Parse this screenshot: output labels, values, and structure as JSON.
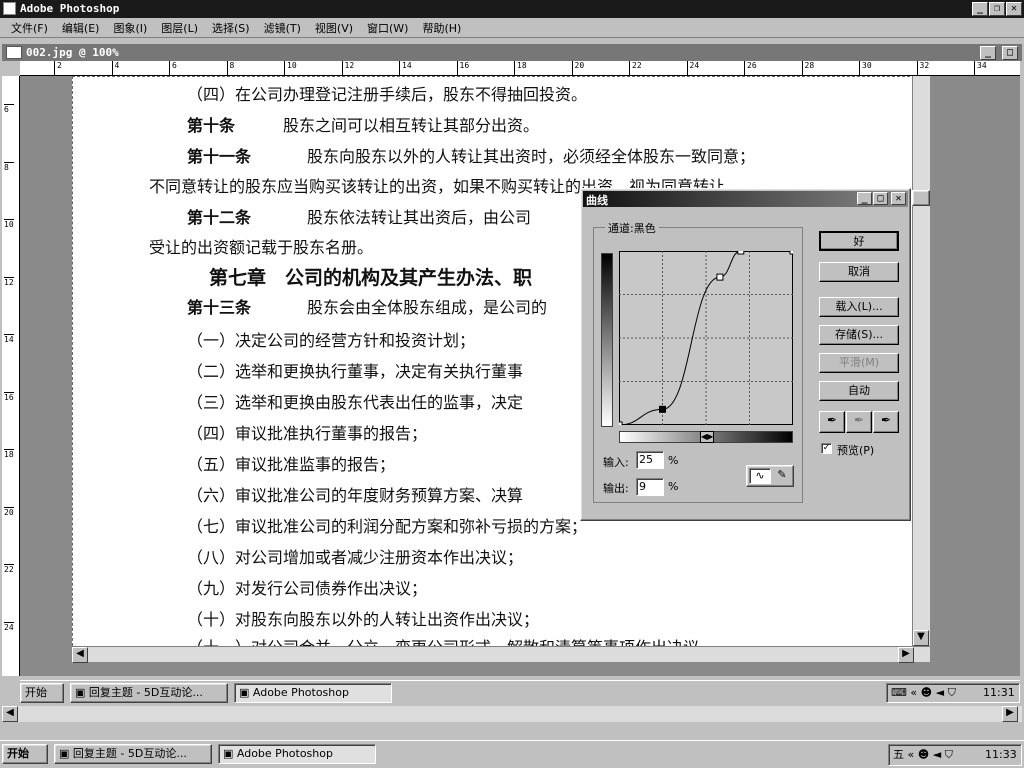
{
  "app": {
    "title": "Adobe Photoshop"
  },
  "menu": [
    "文件(F)",
    "编辑(E)",
    "图象(I)",
    "图层(L)",
    "选择(S)",
    "滤镜(T)",
    "视图(V)",
    "窗口(W)",
    "帮助(H)"
  ],
  "document": {
    "title": "002.jpg @ 100%",
    "ruler_h": [
      "2",
      "4",
      "6",
      "8",
      "10",
      "12",
      "14",
      "16",
      "18",
      "20",
      "22",
      "24",
      "26",
      "28",
      "30",
      "32",
      "34"
    ],
    "ruler_v": [
      "6",
      "8",
      "10",
      "12",
      "14",
      "16",
      "18",
      "20",
      "22",
      "24"
    ],
    "lines": [
      "（四）在公司办理登记注册手续后，股东不得抽回投资。",
      "第十条",
      "股东之间可以相互转让其部分出资。",
      "第十一条",
      "股东向股东以外的人转让其出资时，必须经全体股东一致同意；",
      "不同意转让的股东应当购买该转让的出资，如果不购买转让的出资，视为同意转让。",
      "第十二条",
      "股东依法转让其出资后，由公司",
      "受让的出资额记载于股东名册。",
      "第七章　公司的机构及其产生办法、职",
      "第十三条",
      "股东会由全体股东组成，是公司的",
      "（一）决定公司的经营方针和投资计划；",
      "（二）选举和更换执行董事，决定有关执行董事",
      "（三）选举和更换由股东代表出任的监事，决定",
      "（四）审议批准执行董事的报告；",
      "（五）审议批准监事的报告；",
      "（六）审议批准公司的年度财务预算方案、决算",
      "（七）审议批准公司的利润分配方案和弥补亏损的方案；",
      "（八）对公司增加或者减少注册资本作出决议；",
      "（九）对发行公司债券作出决议；",
      "（十）对股东向股东以外的人转让出资作出决议；",
      "（十一）对公司合并、分立、变更公司形式、解散和清算等事项作出决议。"
    ]
  },
  "curves": {
    "title": "曲线",
    "channel_label": "通道:",
    "channel_value": "黑色",
    "buttons": {
      "ok": "好",
      "cancel": "取消",
      "load": "载入(L)...",
      "save": "存储(S)...",
      "smooth": "平滑(M)",
      "auto": "自动"
    },
    "preview_label": "预览(P)",
    "preview_checked": true,
    "input_label": "输入:",
    "input_value": "25",
    "output_label": "输出:",
    "output_value": "9",
    "percent": "%",
    "points": [
      [
        0,
        0
      ],
      [
        25,
        9
      ],
      [
        58,
        85
      ],
      [
        70,
        100
      ],
      [
        100,
        100
      ]
    ]
  },
  "taskbar_inner": {
    "start": "开始",
    "tasks": [
      "回复主题 - 5D互动论...",
      "Adobe Photoshop"
    ],
    "time": "11:31"
  },
  "taskbar": {
    "start": "开始",
    "tasks": [
      "回复主题 - 5D互动论...",
      "Adobe Photoshop"
    ],
    "time": "11:33"
  },
  "colors": {
    "title_bg": "#1a1a1a",
    "face": "#c0c0c0",
    "canvas_bg": "#8a8a8a"
  }
}
